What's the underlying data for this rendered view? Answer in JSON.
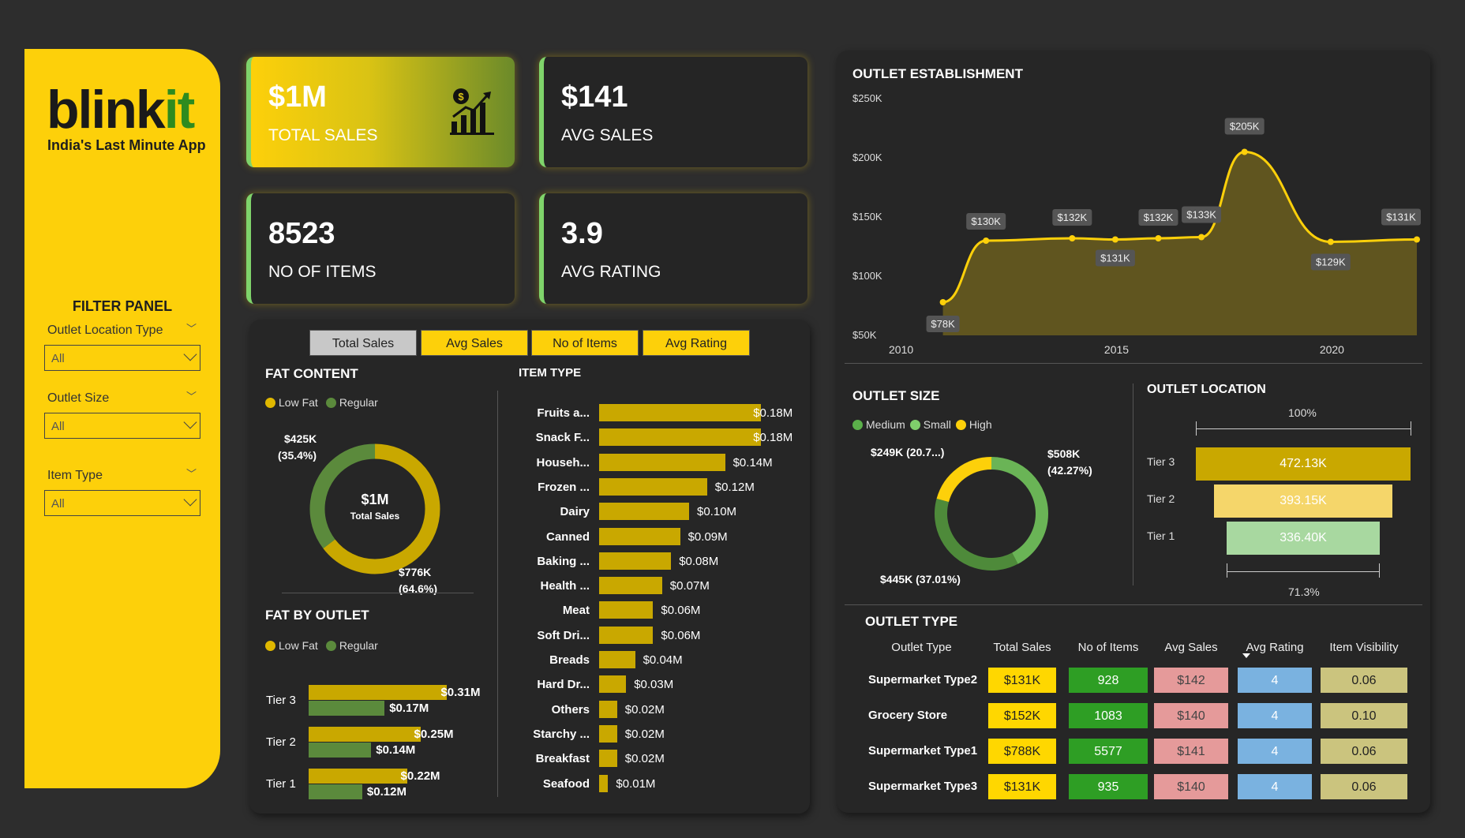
{
  "sidebar": {
    "logo_main": "blink",
    "logo_accent": "it",
    "tagline": "India's Last Minute App",
    "filter_panel_title": "FILTER PANEL",
    "filters": [
      {
        "label": "Outlet Location Type",
        "value": "All"
      },
      {
        "label": "Outlet Size",
        "value": "All"
      },
      {
        "label": "Item Type",
        "value": "All"
      }
    ]
  },
  "kpis": [
    {
      "value": "$1M",
      "label": "TOTAL SALES",
      "icon": "sales-chart-icon"
    },
    {
      "value": "$141",
      "label": "AVG SALES"
    },
    {
      "value": "8523",
      "label": "NO OF ITEMS"
    },
    {
      "value": "3.9",
      "label": "AVG RATING"
    }
  ],
  "tabs": [
    "Total Sales",
    "Avg Sales",
    "No of Items",
    "Avg Rating"
  ],
  "colors": {
    "yellow": "#fdd00a",
    "gold": "#c9a800",
    "green": "#5b8a3c",
    "lightgreen": "#7fd46b",
    "bg": "#2d2d2d"
  },
  "fat_content": {
    "title": "FAT CONTENT",
    "legend": [
      "Low Fat",
      "Regular"
    ],
    "center_value": "$1M",
    "center_label": "Total Sales",
    "regular_label": "$425K",
    "regular_pct": "(35.4%)",
    "lowfat_label": "$776K",
    "lowfat_pct": "(64.6%)"
  },
  "fat_by_outlet": {
    "title": "FAT BY OUTLET",
    "legend": [
      "Low Fat",
      "Regular"
    ]
  },
  "item_type": {
    "title": "ITEM TYPE"
  },
  "outlet_est": {
    "title": "OUTLET ESTABLISHMENT"
  },
  "outlet_size": {
    "title": "OUTLET SIZE",
    "legend": [
      "Medium",
      "Small",
      "High"
    ],
    "label_high": "$249K (20.7...)",
    "label_medium": "$508K",
    "label_medium_pct": "(42.27%)",
    "label_small": "$445K (37.01%)"
  },
  "outlet_location": {
    "title": "OUTLET LOCATION",
    "top_pct": "100%",
    "bottom_pct": "71.3%"
  },
  "outlet_type": {
    "title": "OUTLET TYPE",
    "headers": [
      "Outlet Type",
      "Total Sales",
      "No of Items",
      "Avg Sales",
      "Avg Rating",
      "Item Visibility"
    ],
    "rows": [
      [
        "Supermarket Type2",
        "$131K",
        "928",
        "$142",
        "4",
        "0.06"
      ],
      [
        "Grocery Store",
        "$152K",
        "1083",
        "$140",
        "4",
        "0.10"
      ],
      [
        "Supermarket Type1",
        "$788K",
        "5577",
        "$141",
        "4",
        "0.06"
      ],
      [
        "Supermarket Type3",
        "$131K",
        "935",
        "$140",
        "4",
        "0.06"
      ]
    ]
  },
  "chart_data": [
    {
      "type": "pie",
      "title": "FAT CONTENT",
      "categories": [
        "Low Fat",
        "Regular"
      ],
      "values": [
        776,
        425
      ],
      "units": "$K",
      "center": "$1M Total Sales"
    },
    {
      "type": "bar",
      "title": "FAT BY OUTLET",
      "categories": [
        "Tier 3",
        "Tier 2",
        "Tier 1"
      ],
      "series": [
        {
          "name": "Low Fat",
          "values": [
            0.31,
            0.25,
            0.22
          ],
          "labels": [
            "$0.31M",
            "$0.25M",
            "$0.22M"
          ]
        },
        {
          "name": "Regular",
          "values": [
            0.17,
            0.14,
            0.12
          ],
          "labels": [
            "$0.17M",
            "$0.14M",
            "$0.12M"
          ]
        }
      ]
    },
    {
      "type": "bar",
      "title": "ITEM TYPE",
      "categories": [
        "Fruits a...",
        "Snack F...",
        "Househ...",
        "Frozen ...",
        "Dairy",
        "Canned",
        "Baking ...",
        "Health ...",
        "Meat",
        "Soft Dri...",
        "Breads",
        "Hard Dr...",
        "Others",
        "Starchy ...",
        "Breakfast",
        "Seafood"
      ],
      "values": [
        0.18,
        0.18,
        0.14,
        0.12,
        0.1,
        0.09,
        0.08,
        0.07,
        0.06,
        0.06,
        0.04,
        0.03,
        0.02,
        0.02,
        0.02,
        0.01
      ],
      "labels": [
        "$0.18M",
        "$0.18M",
        "$0.14M",
        "$0.12M",
        "$0.10M",
        "$0.09M",
        "$0.08M",
        "$0.07M",
        "$0.06M",
        "$0.06M",
        "$0.04M",
        "$0.03M",
        "$0.02M",
        "$0.02M",
        "$0.02M",
        "$0.01M"
      ]
    },
    {
      "type": "area",
      "title": "OUTLET ESTABLISHMENT",
      "x": [
        2011,
        2012,
        2014,
        2015,
        2016,
        2017,
        2018,
        2020,
        2022
      ],
      "y": [
        78,
        130,
        132,
        131,
        132,
        133,
        205,
        129,
        131
      ],
      "labels": [
        "$78K",
        "$130K",
        "$132K",
        "$131K",
        "$132K",
        "$133K",
        "$205K",
        "$129K",
        "$131K"
      ],
      "xticks": [
        "2010",
        "2015",
        "2020"
      ],
      "yticks": [
        "$50K",
        "$100K",
        "$150K",
        "$200K",
        "$250K"
      ],
      "ylim": [
        50,
        250
      ],
      "xlim": [
        2010,
        2022
      ]
    },
    {
      "type": "pie",
      "title": "OUTLET SIZE",
      "categories": [
        "Medium",
        "Small",
        "High"
      ],
      "values": [
        508,
        445,
        249
      ]
    },
    {
      "type": "bar",
      "title": "OUTLET LOCATION",
      "categories": [
        "Tier 3",
        "Tier 2",
        "Tier 1"
      ],
      "values": [
        472.13,
        393.15,
        336.4
      ],
      "labels": [
        "472.13K",
        "393.15K",
        "336.40K"
      ]
    }
  ]
}
